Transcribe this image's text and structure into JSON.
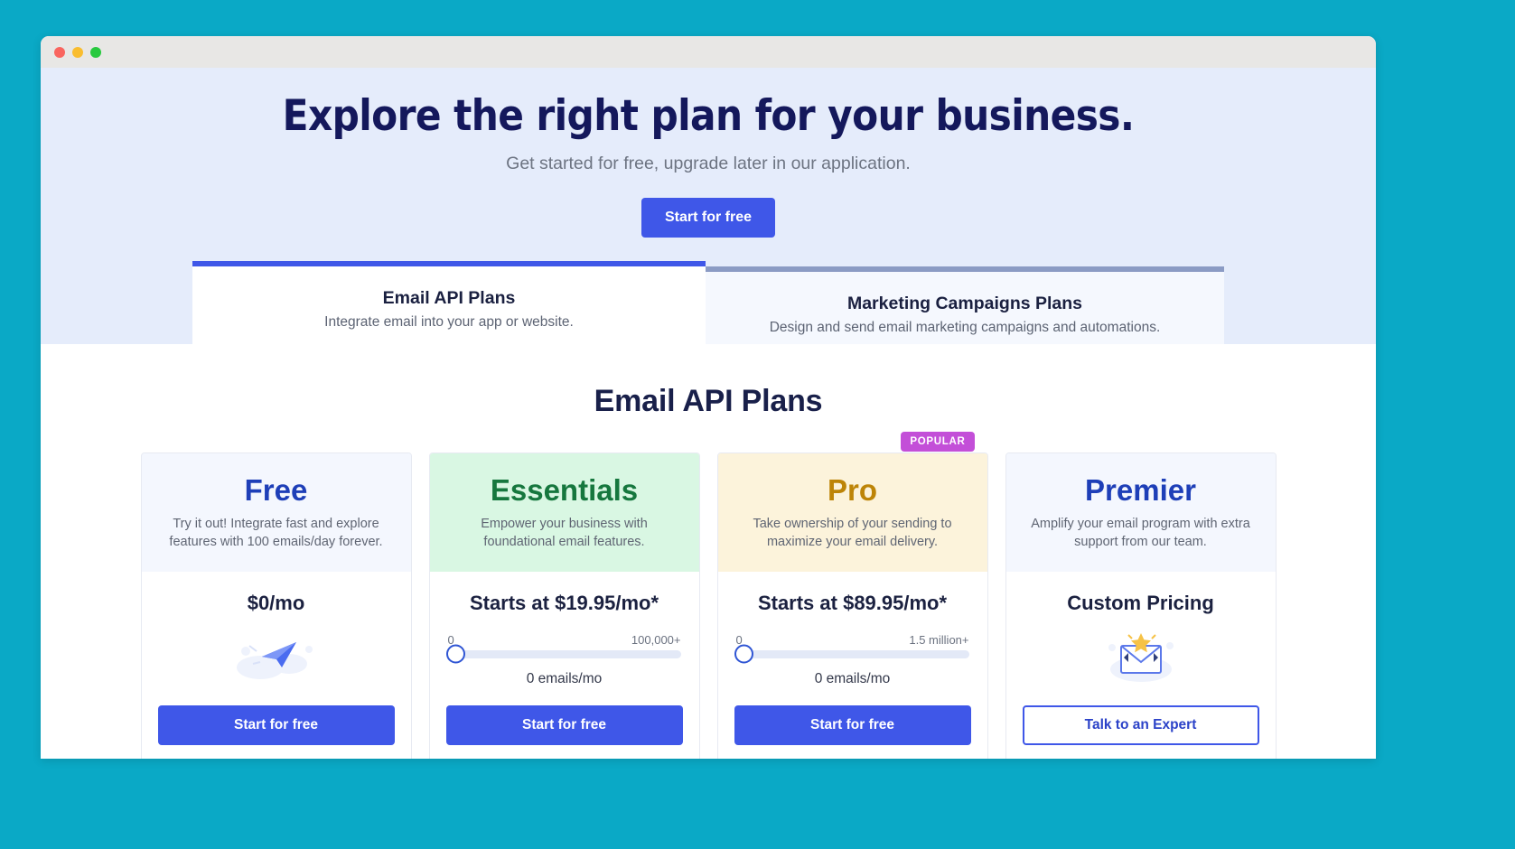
{
  "window": {
    "traffic_lights": [
      "close",
      "minimize",
      "maximize"
    ]
  },
  "hero": {
    "title": "Explore the right plan for your business.",
    "subtitle": "Get started for free, upgrade later in our application.",
    "cta_label": "Start for free"
  },
  "tabs": [
    {
      "id": "email-api",
      "label": "Email API Plans",
      "description": "Integrate email into your app or website.",
      "active": true
    },
    {
      "id": "marketing-campaigns",
      "label": "Marketing Campaigns Plans",
      "description": "Design and send email marketing campaigns and automations.",
      "active": false
    }
  ],
  "plans_section": {
    "title": "Email API Plans"
  },
  "plans": [
    {
      "name": "Free",
      "description": "Try it out! Integrate fast and explore features with 100 emails/day forever.",
      "price": "$0/mo",
      "has_slider": false,
      "illustration": "paper-plane-illustration",
      "cta_label": "Start for free",
      "cta_style": "solid",
      "badge": null,
      "theme": "blue"
    },
    {
      "name": "Essentials",
      "description": "Empower your business with foundational email features.",
      "price": "Starts at $19.95/mo*",
      "has_slider": true,
      "slider_min_label": "0",
      "slider_max_label": "100,000+",
      "slider_value_label": "0 emails/mo",
      "slider_position_percent": 0,
      "cta_label": "Start for free",
      "cta_style": "solid",
      "badge": null,
      "theme": "green"
    },
    {
      "name": "Pro",
      "description": "Take ownership of your sending to maximize your email delivery.",
      "price": "Starts at $89.95/mo*",
      "has_slider": true,
      "slider_min_label": "0",
      "slider_max_label": "1.5 million+",
      "slider_value_label": "0 emails/mo",
      "slider_position_percent": 0,
      "cta_label": "Start for free",
      "cta_style": "solid",
      "badge": "POPULAR",
      "theme": "gold"
    },
    {
      "name": "Premier",
      "description": "Amplify your email program with extra support from our team.",
      "price": "Custom Pricing",
      "has_slider": false,
      "illustration": "envelope-star-illustration",
      "cta_label": "Talk to an Expert",
      "cta_style": "outline",
      "badge": null,
      "theme": "blue"
    }
  ],
  "colors": {
    "page_background": "#0aa9c6",
    "hero_background": "#e5ecfb",
    "accent_blue": "#3f57e8",
    "navy": "#14185c",
    "badge_magenta": "#c34fd8",
    "green": "#16773e",
    "gold": "#bd8407"
  }
}
